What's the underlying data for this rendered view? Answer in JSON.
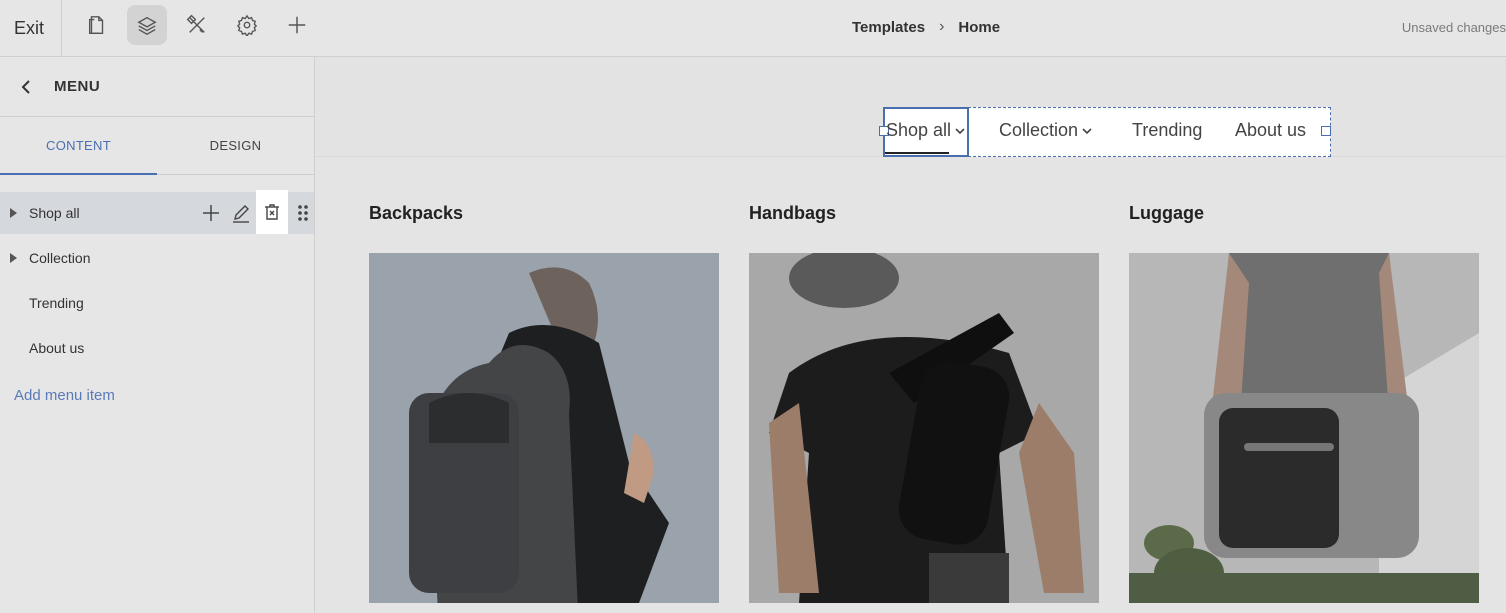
{
  "topbar": {
    "exit_label": "Exit",
    "tools": [
      {
        "icon": "page-icon",
        "active": false
      },
      {
        "icon": "layers-icon",
        "active": true
      },
      {
        "icon": "design-tools-icon",
        "active": false
      },
      {
        "icon": "gear-icon",
        "active": false
      },
      {
        "icon": "plus-icon",
        "active": false
      }
    ],
    "breadcrumb": [
      "Templates",
      "Home"
    ],
    "status": "Unsaved changes"
  },
  "panel": {
    "title": "MENU",
    "tabs": [
      {
        "label": "CONTENT",
        "active": true
      },
      {
        "label": "DESIGN",
        "active": false
      }
    ],
    "items": [
      {
        "label": "Shop all",
        "has_children": true,
        "selected": true
      },
      {
        "label": "Collection",
        "has_children": true,
        "selected": false
      },
      {
        "label": "Trending",
        "has_children": false,
        "selected": false
      },
      {
        "label": "About us",
        "has_children": false,
        "selected": false
      }
    ],
    "add_item_label": "Add menu item"
  },
  "canvas": {
    "nav": [
      {
        "label": "Shop all",
        "dropdown": true,
        "selected": true
      },
      {
        "label": "Collection",
        "dropdown": true
      },
      {
        "label": "Trending",
        "dropdown": false
      },
      {
        "label": "About us",
        "dropdown": false
      }
    ],
    "categories": [
      {
        "title": "Backpacks"
      },
      {
        "title": "Handbags"
      },
      {
        "title": "Luggage"
      }
    ]
  },
  "colors": {
    "accent": "#4a6fb0",
    "overlay_gray": "#e4e4e4"
  }
}
